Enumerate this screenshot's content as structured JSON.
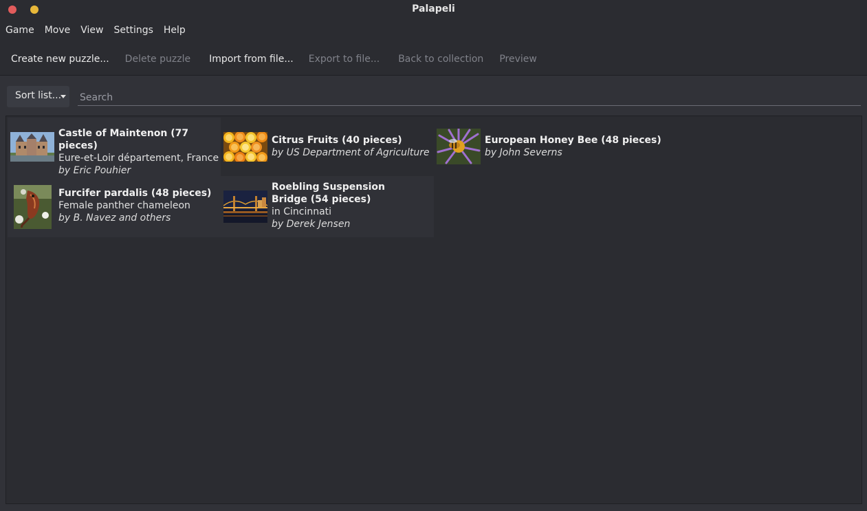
{
  "window": {
    "title": "Palapeli"
  },
  "menubar": [
    "Game",
    "Move",
    "View",
    "Settings",
    "Help"
  ],
  "toolbar": {
    "create": "Create new puzzle...",
    "delete": "Delete puzzle",
    "import": "Import from file...",
    "export": "Export to file...",
    "back": "Back to collection",
    "preview": "Preview"
  },
  "filter": {
    "sort_label": "Sort list...",
    "search_placeholder": "Search"
  },
  "puzzles": [
    {
      "title": "Castle of Maintenon (77 pieces)",
      "comment": "Eure-et-Loir département, France",
      "author": "by Eric Pouhier",
      "thumb": "castle-thumbnail"
    },
    {
      "title": "Citrus Fruits (40 pieces)",
      "comment": "",
      "author": "by US Department of Agriculture",
      "thumb": "citrus-thumbnail"
    },
    {
      "title": "European Honey Bee (48 pieces)",
      "comment": "",
      "author": "by John Severns",
      "thumb": "bee-thumbnail"
    },
    {
      "title": "Furcifer pardalis (48 pieces)",
      "comment": "Female panther chameleon",
      "author": "by B. Navez and others",
      "thumb": "chameleon-thumbnail"
    },
    {
      "title": "Roebling Suspension Bridge (54 pieces)",
      "comment": "in Cincinnati",
      "author": "by Derek Jensen",
      "thumb": "bridge-thumbnail"
    }
  ]
}
